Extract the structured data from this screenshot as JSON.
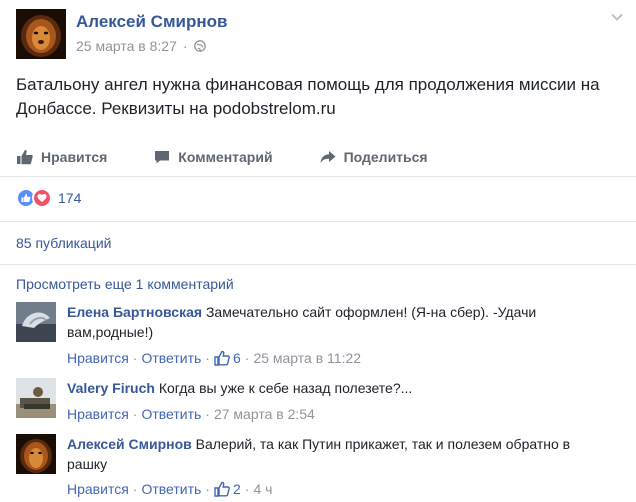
{
  "post": {
    "author": "Алексей Смирнов",
    "date": "25 марта в 8:27",
    "text": "Батальону ангел нужна финансовая помощь для продолжения миссии на Донбассе. Реквизиты на podobstrelom.ru",
    "actions": {
      "like": "Нравится",
      "comment": "Комментарий",
      "share": "Поделиться"
    },
    "reactions_count": "174",
    "shares": "85 публикаций",
    "more_comments": "Просмотреть еще 1 комментарий"
  },
  "comments": [
    {
      "author": "Елена Бартновская",
      "text": "Замечательно сайт оформлен! (Я-на сбер). -Удачи вам,родные!)",
      "like": "Нравится",
      "reply": "Ответить",
      "likes": "6",
      "time": "25 марта в 11:22"
    },
    {
      "author": "Valery Firuch",
      "text": "Когда вы уже к себе назад полезете?...",
      "like": "Нравится",
      "reply": "Ответить",
      "time": "27 марта в 2:54"
    },
    {
      "author": "Алексей Смирнов",
      "text": "Валерий, та как Путин прикажет, так и полезем обратно в рашку",
      "like": "Нравится",
      "reply": "Ответить",
      "likes": "2",
      "time": "4 ч"
    }
  ],
  "colors": {
    "link": "#365899",
    "muted": "#90949c",
    "like_reaction": "#5890ff",
    "love_reaction": "#f25268"
  }
}
